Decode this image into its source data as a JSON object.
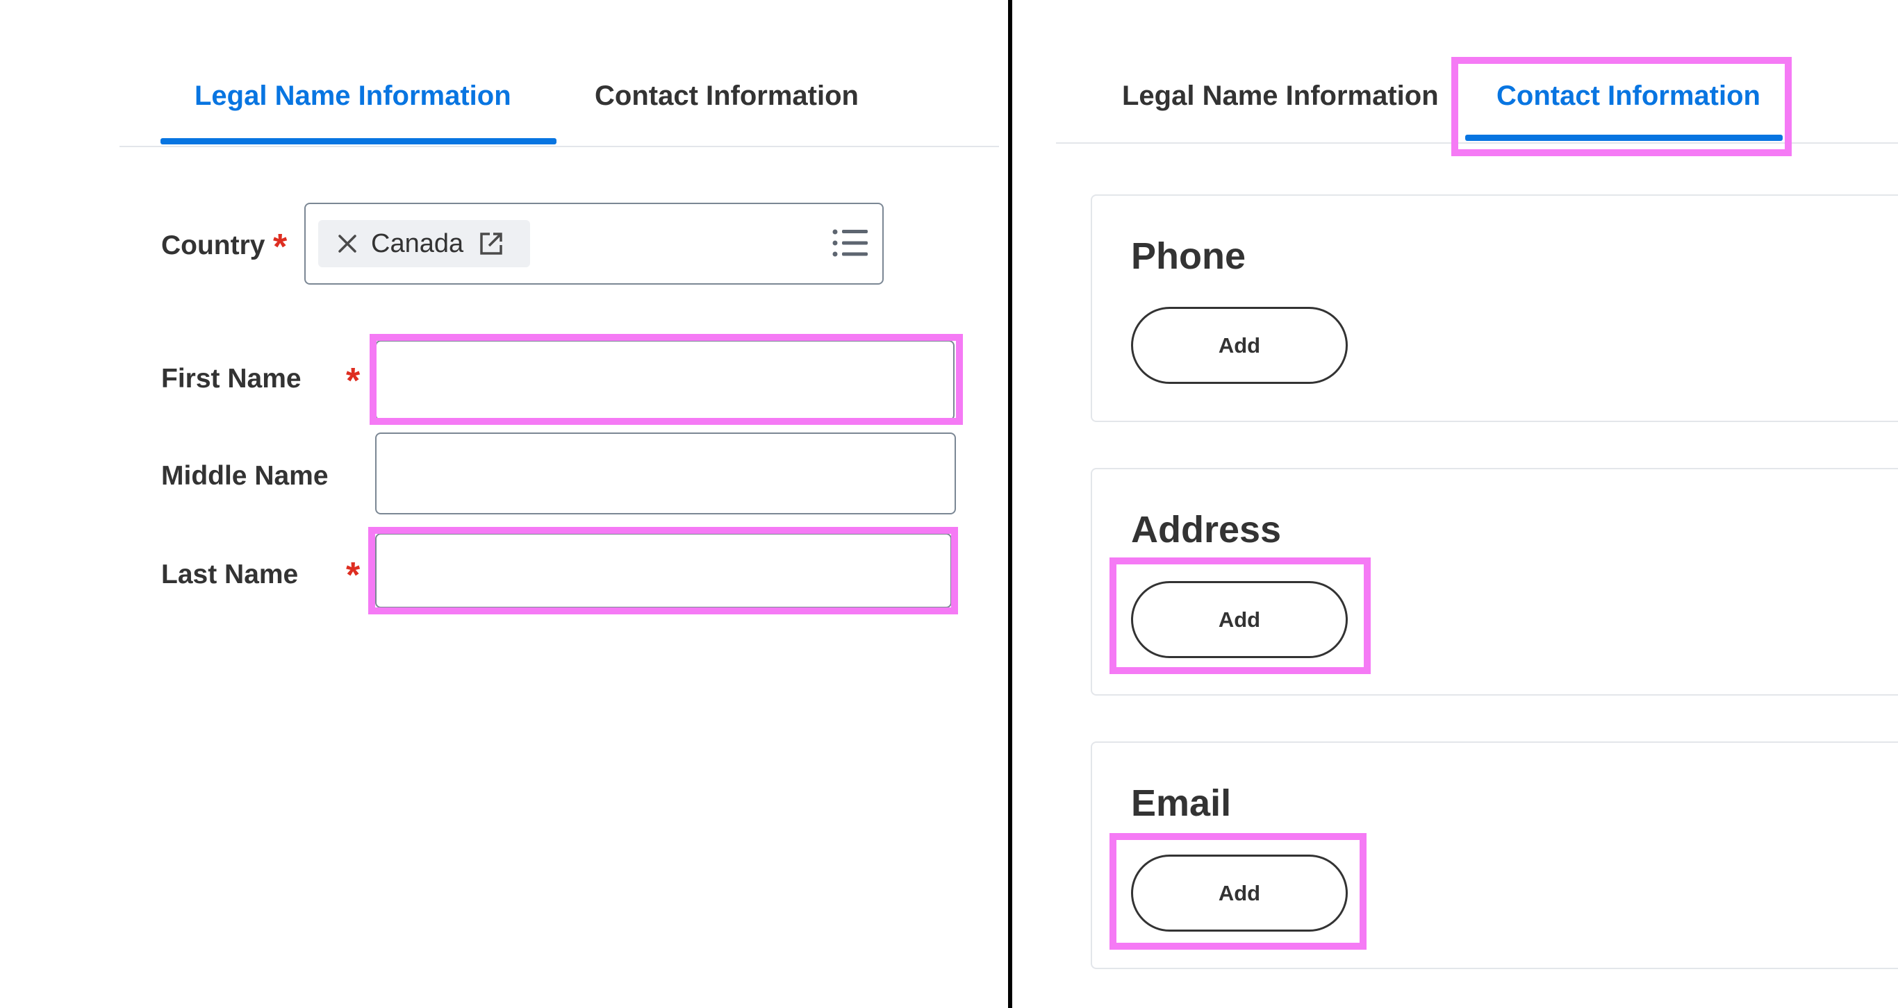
{
  "left_panel": {
    "tabs": [
      {
        "label": "Legal Name Information",
        "active": true
      },
      {
        "label": "Contact Information",
        "active": false
      }
    ],
    "country": {
      "label": "Country",
      "required_mark": "*",
      "selected_value": "Canada"
    },
    "fields": [
      {
        "label": "First Name",
        "required_mark": "*",
        "value": ""
      },
      {
        "label": "Middle Name",
        "value": ""
      },
      {
        "label": "Last Name",
        "required_mark": "*",
        "value": ""
      }
    ]
  },
  "right_panel": {
    "tabs": [
      {
        "label": "Legal Name Information",
        "active": false
      },
      {
        "label": "Contact Information",
        "active": true
      }
    ],
    "sections": [
      {
        "title": "Phone",
        "button_label": "Add"
      },
      {
        "title": "Address",
        "button_label": "Add"
      },
      {
        "title": "Email",
        "button_label": "Add"
      }
    ]
  },
  "colors": {
    "accent": "#0875e1",
    "required": "#de2e21",
    "highlight": "#f57af5",
    "text": "#333333",
    "border": "#7b8794"
  },
  "icons": [
    "close-icon",
    "external-link-icon",
    "list-icon"
  ]
}
